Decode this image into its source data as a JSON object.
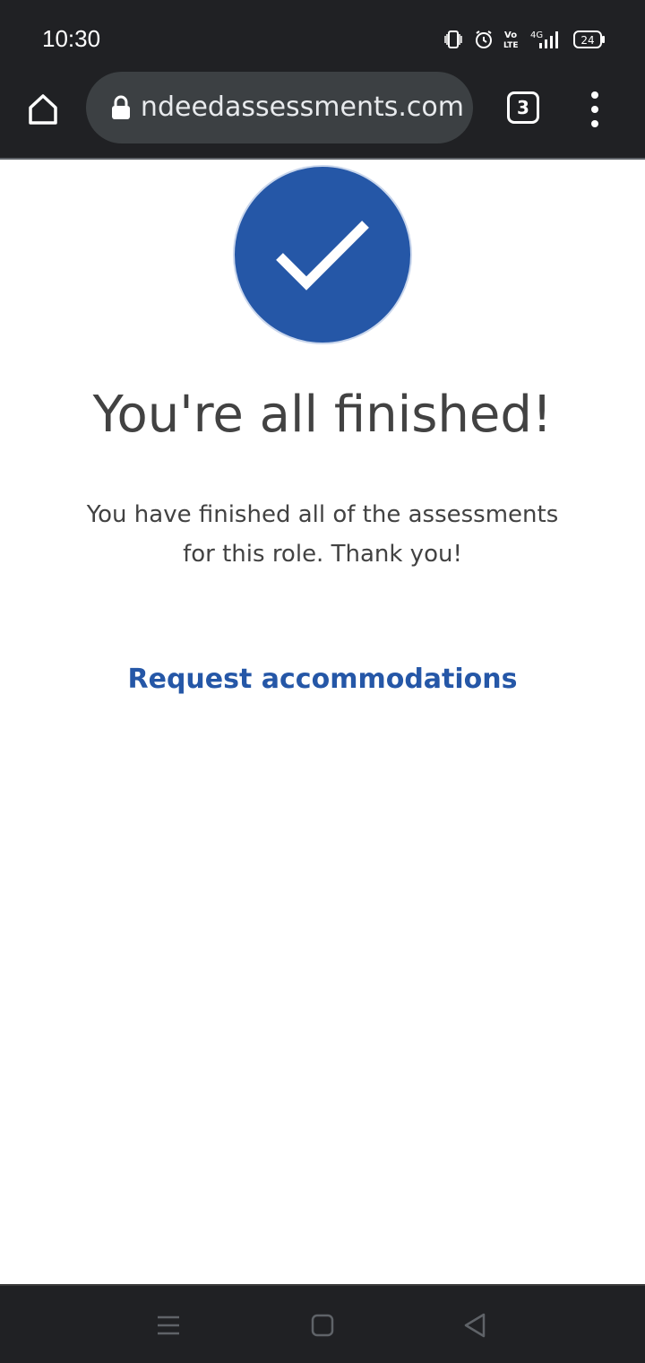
{
  "status_bar": {
    "time": "10:30",
    "network": "4G",
    "volte": "Vo LTE",
    "battery": "24",
    "icons": [
      "vibrate-icon",
      "alarm-icon",
      "volte-icon",
      "signal-icon",
      "battery-icon"
    ]
  },
  "browser": {
    "url": "indeedassessments.com",
    "tab_count": "3",
    "icons": [
      "home-icon",
      "lock-icon",
      "tabs-icon",
      "more-vert-icon"
    ]
  },
  "page": {
    "icon": "checkmark-icon",
    "title": "You're all finished!",
    "message": "You have finished all of the assessments for this role. Thank you!",
    "link": "Request accommodations"
  },
  "nav": {
    "icons": [
      "recents-icon",
      "home-nav-icon",
      "back-icon"
    ]
  },
  "colors": {
    "accent": "#2557a7",
    "text": "#424242",
    "chrome": "#202124"
  }
}
